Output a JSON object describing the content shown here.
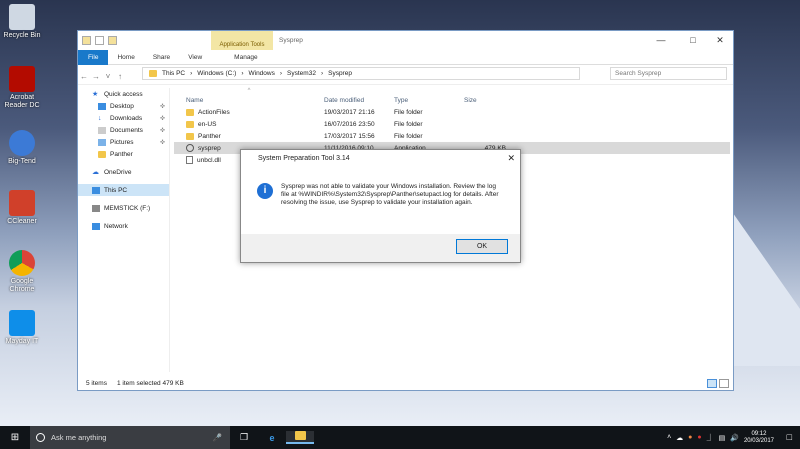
{
  "desktop": {
    "icons": [
      {
        "label": "Recycle Bin",
        "icon": "recycle-bin-icon",
        "color": "#cfd8e3"
      },
      {
        "label": "Acrobat Reader DC",
        "icon": "acrobat-icon",
        "color": "#b30b00"
      },
      {
        "label": "Big-Tend",
        "icon": "bigtend-icon",
        "color": "#3c7ad6"
      },
      {
        "label": "CCleaner",
        "icon": "ccleaner-icon",
        "color": "#d0402a"
      },
      {
        "label": "Google Chrome",
        "icon": "chrome-icon",
        "color": "#2e9d4b"
      },
      {
        "label": "Mayday IT",
        "icon": "teamviewer-icon",
        "color": "#0e8ee9"
      }
    ]
  },
  "explorer": {
    "context_tab": "Application Tools",
    "title": "Sysprep",
    "tabs": [
      "File",
      "Home",
      "Share",
      "View",
      "Manage"
    ],
    "path": [
      "This PC",
      "Windows (C:)",
      "Windows",
      "System32",
      "Sysprep"
    ],
    "search_placeholder": "Search Sysprep",
    "nav": [
      {
        "label": "Quick access",
        "pin": false
      },
      {
        "label": "Desktop",
        "pin": true
      },
      {
        "label": "Downloads",
        "pin": true
      },
      {
        "label": "Documents",
        "pin": true
      },
      {
        "label": "Pictures",
        "pin": true
      },
      {
        "label": "Panther",
        "pin": false
      },
      {
        "label": "OneDrive",
        "pin": false
      },
      {
        "label": "This PC",
        "pin": false
      },
      {
        "label": "MEMSTICK (F:)",
        "pin": false
      },
      {
        "label": "Network",
        "pin": false
      }
    ],
    "columns": [
      "Name",
      "Date modified",
      "Type",
      "Size"
    ],
    "rows": [
      {
        "name": "ActionFiles",
        "date": "19/03/2017 21:16",
        "type": "File folder",
        "size": ""
      },
      {
        "name": "en-US",
        "date": "16/07/2016 23:50",
        "type": "File folder",
        "size": ""
      },
      {
        "name": "Panther",
        "date": "17/03/2017 15:56",
        "type": "File folder",
        "size": ""
      },
      {
        "name": "sysprep",
        "date": "11/11/2016 09:10",
        "type": "Application",
        "size": "479 KB"
      },
      {
        "name": "unbcl.dll",
        "date": "",
        "type": "",
        "size": ""
      }
    ],
    "status": {
      "items": "5 items",
      "selected": "1 item selected  479 KB"
    }
  },
  "dialog": {
    "title": "System Preparation Tool 3.14",
    "message": "Sysprep was not able to validate your Windows installation. Review the log file at %WINDIR%\\System32\\Sysprep\\Panther\\setupact.log for details. After resolving the issue, use Sysprep to validate your installation again.",
    "ok": "OK"
  },
  "taskbar": {
    "search": "Ask me anything",
    "time": "09:12",
    "date": "20/03/2017"
  }
}
